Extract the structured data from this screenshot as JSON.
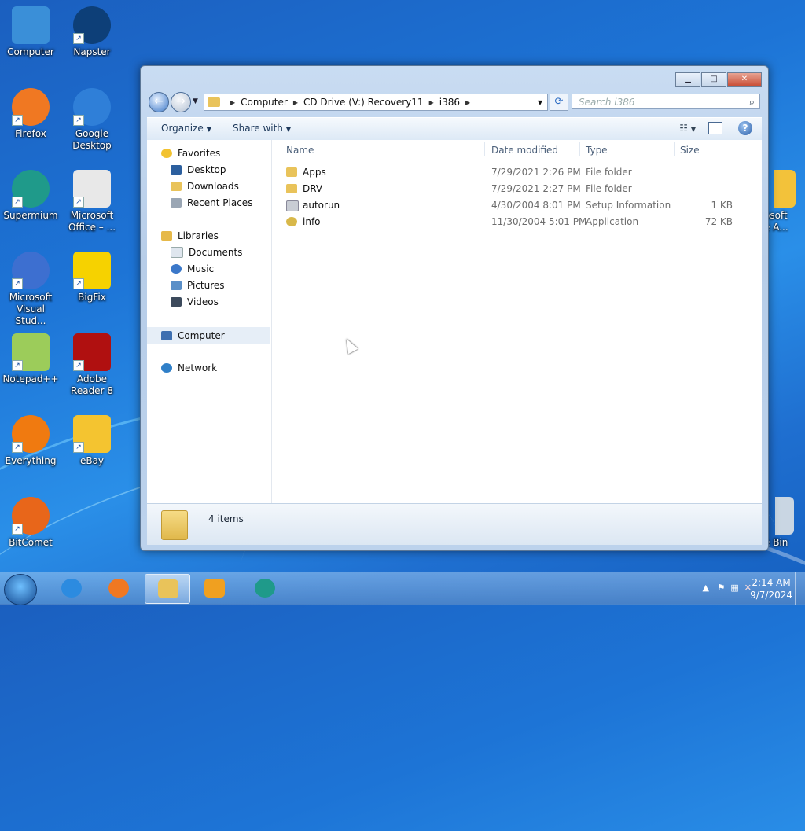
{
  "desktop": {
    "icons": [
      {
        "label": "Computer",
        "icon": "computer-icon",
        "color": "#3a8fd8"
      },
      {
        "label": "Napster",
        "icon": "napster-icon",
        "color": "#0d3f78"
      },
      {
        "label": "Firefox",
        "icon": "firefox-icon",
        "color": "#f07822"
      },
      {
        "label": "Google Desktop",
        "icon": "google-desktop-icon",
        "color": "#2f7fd8"
      },
      {
        "label": "Supermium",
        "icon": "supermium-icon",
        "color": "#1f9a8a"
      },
      {
        "label": "Microsoft Office – ...",
        "icon": "office-icon",
        "color": "#e8e8e8"
      },
      {
        "label": "Microsoft Visual Stud...",
        "icon": "visual-studio-icon",
        "color": "#3d6fd0"
      },
      {
        "label": "BigFix",
        "icon": "bigfix-icon",
        "color": "#f6d200"
      },
      {
        "label": "Notepad++",
        "icon": "notepadpp-icon",
        "color": "#9ccc5a"
      },
      {
        "label": "Adobe Reader 8",
        "icon": "adobe-reader-icon",
        "color": "#b01010"
      },
      {
        "label": "Everything",
        "icon": "everything-icon",
        "color": "#f07a10"
      },
      {
        "label": "eBay",
        "icon": "ebay-icon",
        "color": "#f4c430"
      },
      {
        "label": "BitComet",
        "icon": "bitcomet-icon",
        "color": "#e8661a"
      }
    ],
    "partial_right": [
      {
        "label": "osoft e A..."
      },
      {
        "label": "e Bin"
      }
    ]
  },
  "window": {
    "caption": {
      "minimize": "▁",
      "maximize": "□",
      "close": "✕"
    },
    "back_glyph": "←",
    "forward_glyph": "→",
    "address": [
      "Computer",
      "CD Drive (V:) Recovery11",
      "i386"
    ],
    "search_placeholder": "Search i386",
    "toolbar": {
      "organize": "Organize",
      "share_with": "Share with"
    },
    "nav": {
      "favorites": "Favorites",
      "favorites_items": [
        "Desktop",
        "Downloads",
        "Recent Places"
      ],
      "libraries": "Libraries",
      "libraries_items": [
        "Documents",
        "Music",
        "Pictures",
        "Videos"
      ],
      "computer": "Computer",
      "network": "Network"
    },
    "columns": {
      "name": "Name",
      "date": "Date modified",
      "type": "Type",
      "size": "Size"
    },
    "files": [
      {
        "name": "Apps",
        "date": "7/29/2021 2:26 PM",
        "type": "File folder",
        "size": "",
        "icon": "folder-icon",
        "color": "#e9c35a"
      },
      {
        "name": "DRV",
        "date": "7/29/2021 2:27 PM",
        "type": "File folder",
        "size": "",
        "icon": "folder-icon",
        "color": "#e9c35a"
      },
      {
        "name": "autorun",
        "date": "4/30/2004 8:01 PM",
        "type": "Setup Information",
        "size": "1 KB",
        "icon": "setup-info-icon",
        "color": "#c8ccd4"
      },
      {
        "name": "info",
        "date": "11/30/2004 5:01 PM",
        "type": "Application",
        "size": "72 KB",
        "icon": "application-icon",
        "color": "#d8b84a"
      }
    ],
    "status": "4 items"
  },
  "taskbar": {
    "items": [
      {
        "icon": "internet-explorer-icon",
        "color": "#2c8be0"
      },
      {
        "icon": "firefox-icon",
        "color": "#f07822"
      },
      {
        "icon": "explorer-folder-icon",
        "color": "#e9c35a",
        "active": true
      },
      {
        "icon": "media-player-icon",
        "color": "#f0a020"
      },
      {
        "icon": "supermium-icon",
        "color": "#1f9a8a"
      }
    ],
    "time": "2:14 AM",
    "date": "9/7/2024"
  }
}
